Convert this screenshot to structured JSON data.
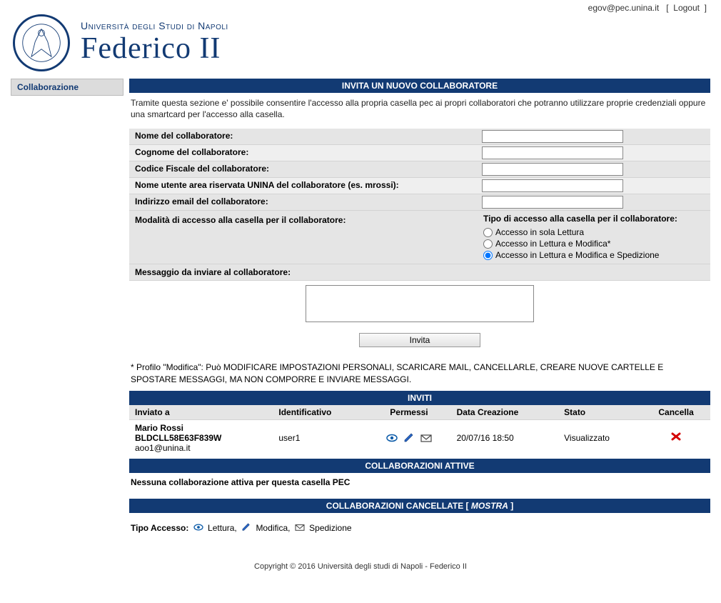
{
  "topbar": {
    "email": "egov@pec.unina.it",
    "logout": "Logout"
  },
  "logo": {
    "line1": "Università degli Studi di Napoli",
    "line2": "Federico II"
  },
  "side": {
    "item1": "Collaborazione"
  },
  "titles": {
    "invite": "INVITA UN NUOVO COLLABORATORE",
    "inviti": "INVITI",
    "active": "COLLABORAZIONI ATTIVE",
    "cancelled_pre": "COLLABORAZIONI CANCELLATE [ ",
    "cancelled_link": "MOSTRA",
    "cancelled_post": " ]"
  },
  "intro": "Tramite questa sezione e' possibile consentire l'accesso alla propria casella pec ai propri collaboratori che potranno utilizzare proprie credenziali oppure una smartcard per l'accesso alla casella.",
  "form": {
    "nome_label": "Nome del collaboratore:",
    "cognome_label": "Cognome del collaboratore:",
    "cf_label": "Codice Fiscale del collaboratore:",
    "utente_label": "Nome utente area riservata UNINA del collaboratore (es. mrossi):",
    "email_label": "Indirizzo email del collaboratore:",
    "modalita_label": "Modalità di accesso alla casella per il collaboratore:",
    "tipo_title": "Tipo di accesso alla casella per il collaboratore:",
    "r1": "Accesso in sola Lettura",
    "r2": "Accesso in Lettura e Modifica*",
    "r3": "Accesso in Lettura e Modifica e Spedizione",
    "msg_label": "Messaggio da inviare al collaboratore:",
    "btn": "Invita"
  },
  "note": "* Profilo \"Modifica\": Può MODIFICARE IMPOSTAZIONI PERSONALI, SCARICARE MAIL, CANCELLARLE, CREARE NUOVE CARTELLE E SPOSTARE MESSAGGI, MA NON COMPORRE E INVIARE MESSAGGI.",
  "table": {
    "h1": "Inviato a",
    "h2": "Identificativo",
    "h3": "Permessi",
    "h4": "Data Creazione",
    "h5": "Stato",
    "h6": "Cancella",
    "row": {
      "name": "Mario Rossi",
      "cf": "BLDCLL58E63F839W",
      "mail": "aoo1@unina.it",
      "user": "user1",
      "date": "20/07/16 18:50",
      "stato": "Visualizzato"
    }
  },
  "noactive": "Nessuna collaborazione attiva per questa casella PEC",
  "legend": {
    "label": "Tipo Accesso:",
    "l1": "Lettura,",
    "l2": "Modifica,",
    "l3": "Spedizione"
  },
  "footer": "Copyright © 2016 Università degli studi di Napoli - Federico II"
}
